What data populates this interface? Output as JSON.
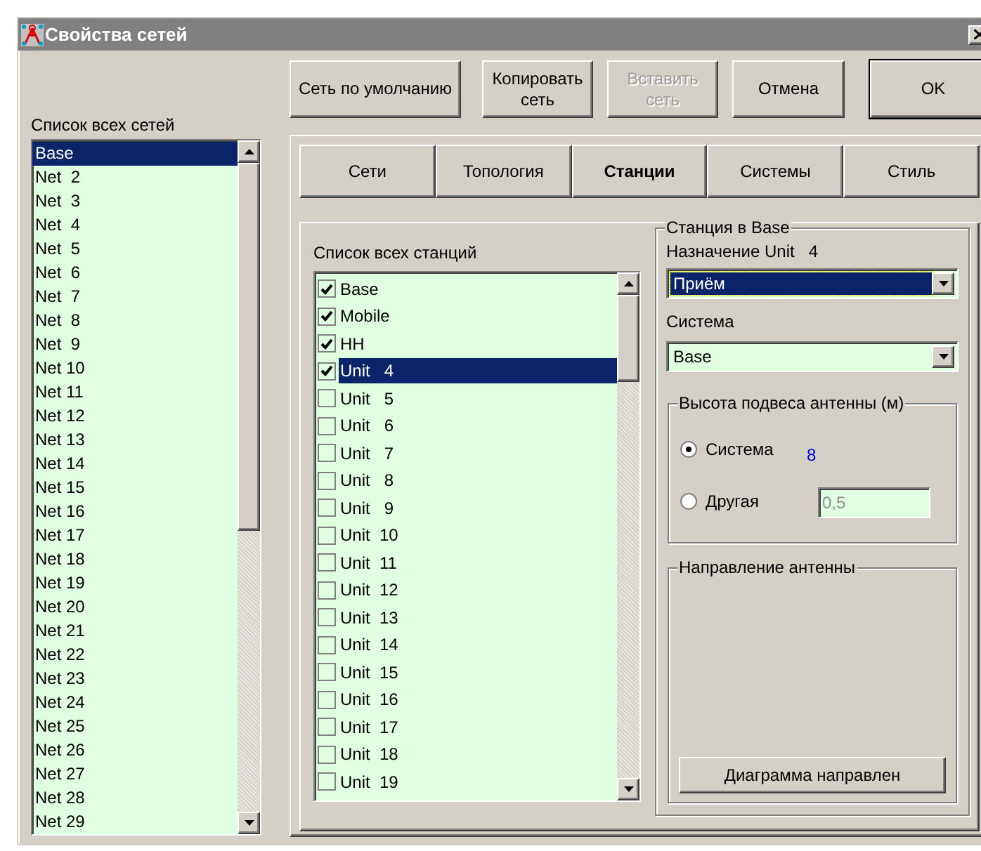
{
  "window": {
    "title": "Свойства сетей"
  },
  "networks_label": "Список всех сетей",
  "networks": [
    {
      "label": "Base",
      "selected": true
    },
    {
      "label": "Net  2",
      "selected": false
    },
    {
      "label": "Net  3",
      "selected": false
    },
    {
      "label": "Net  4",
      "selected": false
    },
    {
      "label": "Net  5",
      "selected": false
    },
    {
      "label": "Net  6",
      "selected": false
    },
    {
      "label": "Net  7",
      "selected": false
    },
    {
      "label": "Net  8",
      "selected": false
    },
    {
      "label": "Net  9",
      "selected": false
    },
    {
      "label": "Net 10",
      "selected": false
    },
    {
      "label": "Net 11",
      "selected": false
    },
    {
      "label": "Net 12",
      "selected": false
    },
    {
      "label": "Net 13",
      "selected": false
    },
    {
      "label": "Net 14",
      "selected": false
    },
    {
      "label": "Net 15",
      "selected": false
    },
    {
      "label": "Net 16",
      "selected": false
    },
    {
      "label": "Net 17",
      "selected": false
    },
    {
      "label": "Net 18",
      "selected": false
    },
    {
      "label": "Net 19",
      "selected": false
    },
    {
      "label": "Net 20",
      "selected": false
    },
    {
      "label": "Net 21",
      "selected": false
    },
    {
      "label": "Net 22",
      "selected": false
    },
    {
      "label": "Net 23",
      "selected": false
    },
    {
      "label": "Net 24",
      "selected": false
    },
    {
      "label": "Net 25",
      "selected": false
    },
    {
      "label": "Net 26",
      "selected": false
    },
    {
      "label": "Net 27",
      "selected": false
    },
    {
      "label": "Net 28",
      "selected": false
    },
    {
      "label": "Net 29",
      "selected": false
    }
  ],
  "buttons": [
    {
      "label": "Сеть по умолчанию",
      "disabled": false,
      "default": false
    },
    {
      "label": "Копировать сеть",
      "disabled": false,
      "default": false
    },
    {
      "label": "Вставить сеть",
      "disabled": true,
      "default": false
    },
    {
      "label": "Отмена",
      "disabled": false,
      "default": false
    },
    {
      "label": "OK",
      "disabled": false,
      "default": true
    }
  ],
  "tabs": [
    {
      "label": "Сети",
      "selected": false
    },
    {
      "label": "Топология",
      "selected": false
    },
    {
      "label": "Станции",
      "selected": true
    },
    {
      "label": "Системы",
      "selected": false
    },
    {
      "label": "Стиль",
      "selected": false
    }
  ],
  "stations_label": "Список всех станций",
  "stations": [
    {
      "label": "Base",
      "checked": true,
      "selected": false
    },
    {
      "label": "Mobile",
      "checked": true,
      "selected": false
    },
    {
      "label": "HH",
      "checked": true,
      "selected": false
    },
    {
      "label": "Unit   4",
      "checked": true,
      "selected": true
    },
    {
      "label": "Unit   5",
      "checked": false,
      "selected": false
    },
    {
      "label": "Unit   6",
      "checked": false,
      "selected": false
    },
    {
      "label": "Unit   7",
      "checked": false,
      "selected": false
    },
    {
      "label": "Unit   8",
      "checked": false,
      "selected": false
    },
    {
      "label": "Unit   9",
      "checked": false,
      "selected": false
    },
    {
      "label": "Unit  10",
      "checked": false,
      "selected": false
    },
    {
      "label": "Unit  11",
      "checked": false,
      "selected": false
    },
    {
      "label": "Unit  12",
      "checked": false,
      "selected": false
    },
    {
      "label": "Unit  13",
      "checked": false,
      "selected": false
    },
    {
      "label": "Unit  14",
      "checked": false,
      "selected": false
    },
    {
      "label": "Unit  15",
      "checked": false,
      "selected": false
    },
    {
      "label": "Unit  16",
      "checked": false,
      "selected": false
    },
    {
      "label": "Unit  17",
      "checked": false,
      "selected": false
    },
    {
      "label": "Unit  18",
      "checked": false,
      "selected": false
    },
    {
      "label": "Unit  19",
      "checked": false,
      "selected": false
    }
  ],
  "station_group": {
    "title": "Станция в Base",
    "assignment_label": "Назначение Unit   4",
    "assignment": {
      "value": "Приём",
      "focused": true
    },
    "system_label": "Система",
    "system": {
      "value": "Base",
      "focused": false
    },
    "height_group": {
      "title": "Высота подвеса антенны (м)",
      "options": [
        {
          "label": "Система",
          "selected": true,
          "value": "8",
          "kind": "reading"
        },
        {
          "label": "Другая",
          "selected": false,
          "value": "0,5",
          "kind": "field",
          "disabled": true
        }
      ]
    },
    "direction_group": {
      "title": "Направление антенны",
      "button": "Диаграмма направлен"
    }
  }
}
